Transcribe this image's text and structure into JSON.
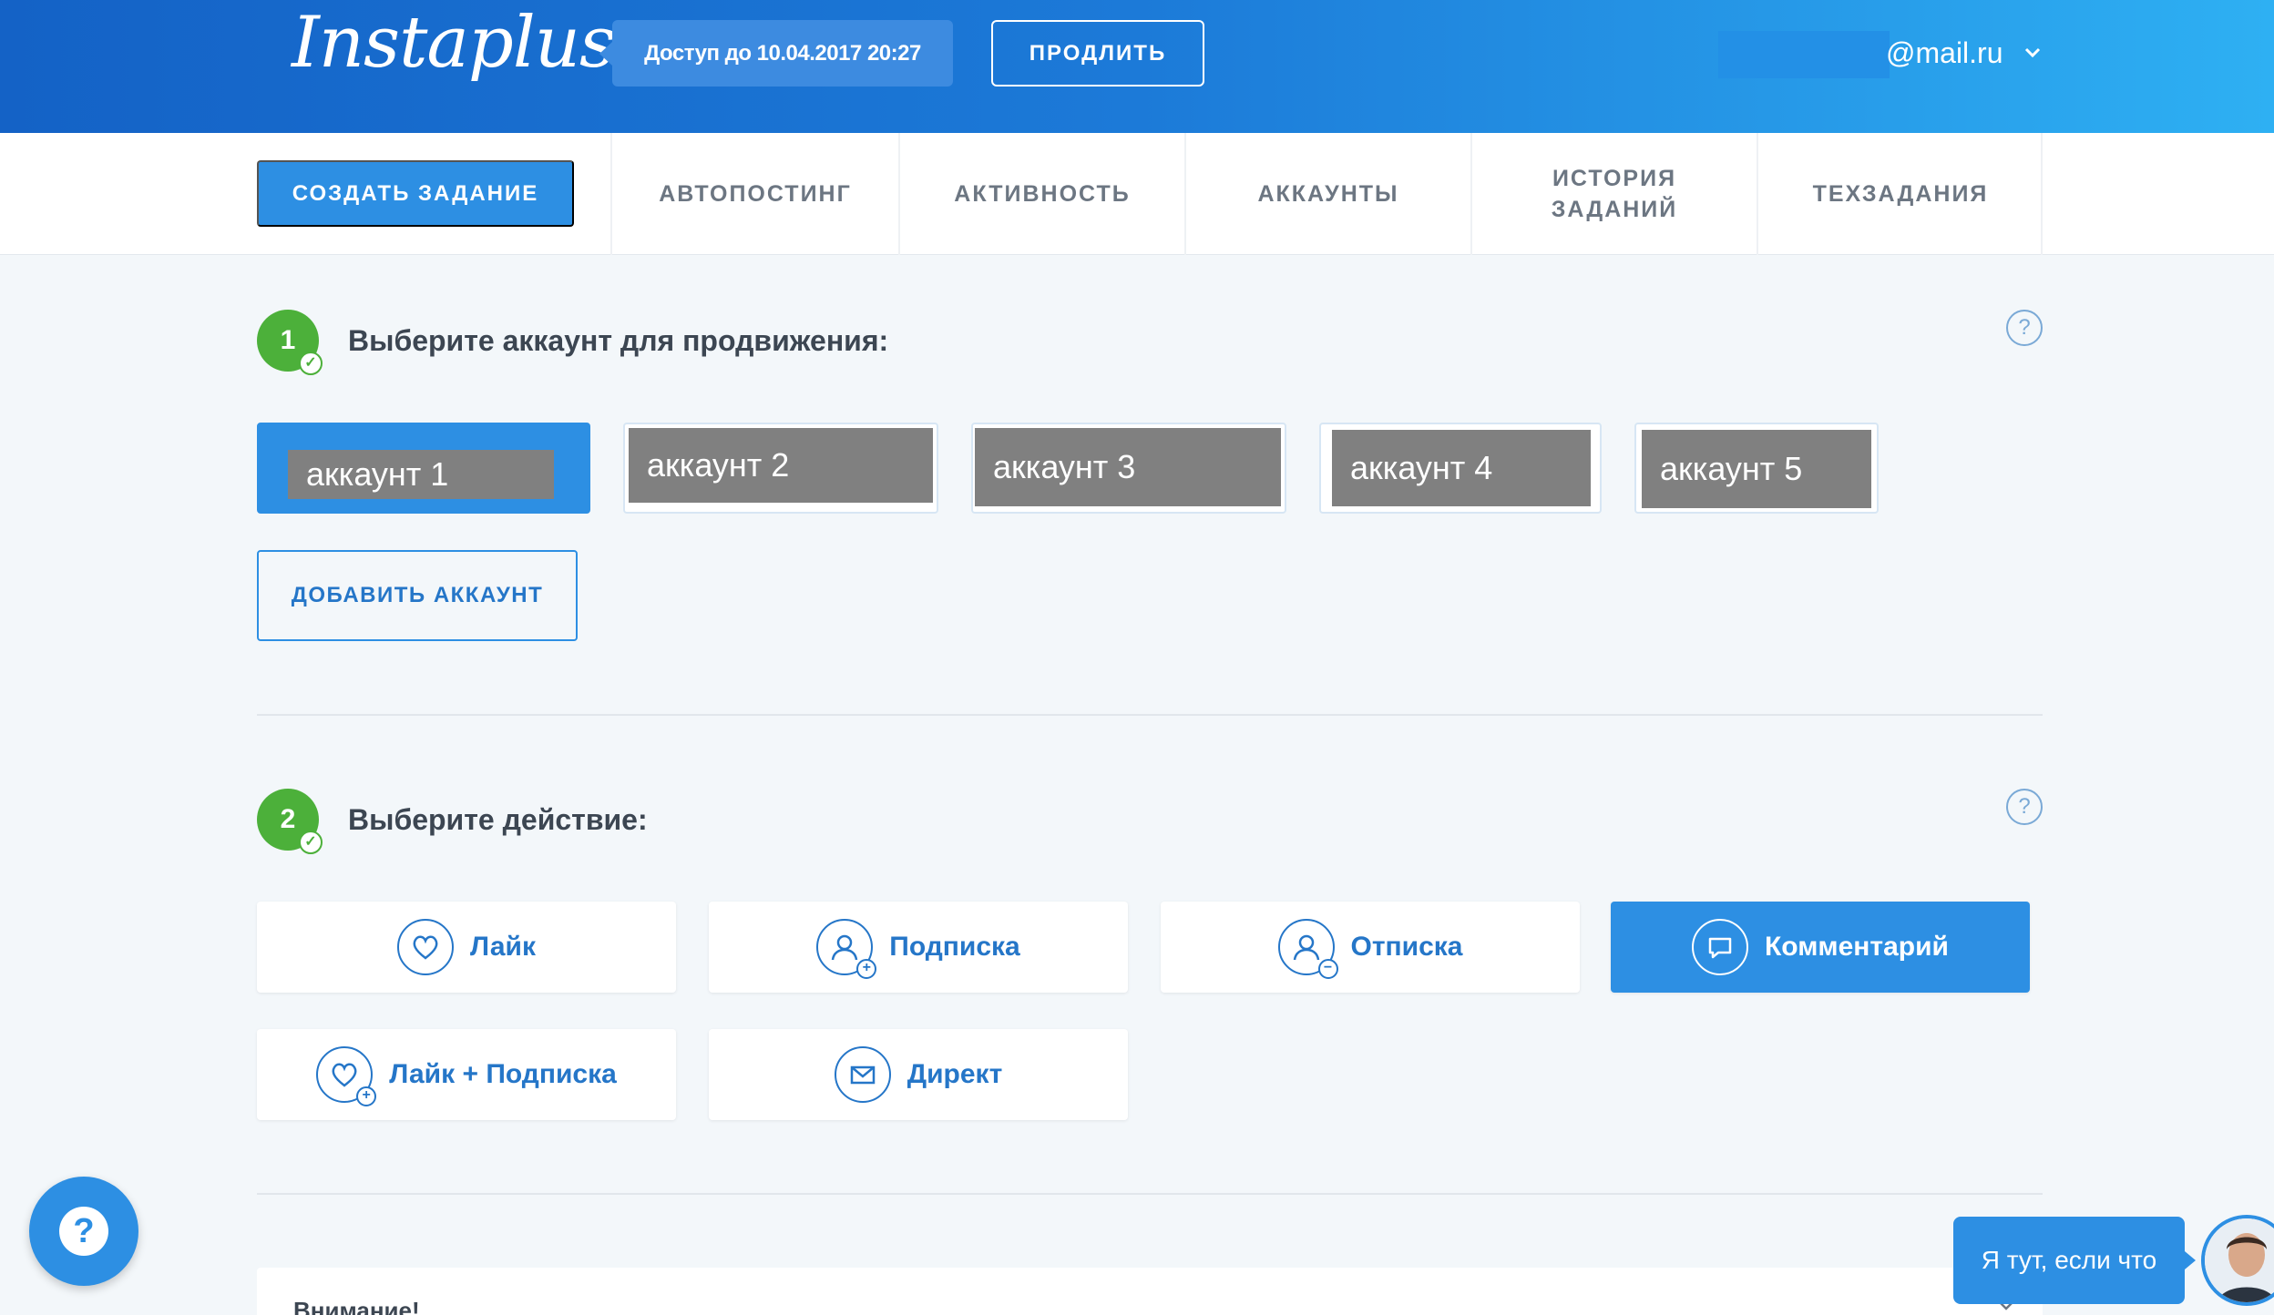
{
  "header": {
    "logo": "Instaplus",
    "access_text": "Доступ до 10.04.2017 20:27",
    "renew_label": "ПРОДЛИТЬ",
    "user_email": "@mail.ru",
    "user_chevron": "⌄"
  },
  "nav": {
    "create_label": "СОЗДАТЬ ЗАДАНИЕ",
    "tabs": [
      {
        "label": "АВТОПОСТИНГ"
      },
      {
        "label": "АКТИВНОСТЬ"
      },
      {
        "label": "АККАУНТЫ"
      },
      {
        "label": "ИСТОРИЯ ЗАДАНИЙ"
      },
      {
        "label": "ТЕХЗАДАНИЯ"
      }
    ]
  },
  "step1": {
    "number": "1",
    "title": "Выберите аккаунт для продвижения:",
    "help": "?",
    "accounts": [
      {
        "label": "аккаунт 1",
        "selected": true
      },
      {
        "label": "аккаунт 2",
        "selected": false
      },
      {
        "label": "аккаунт 3",
        "selected": false
      },
      {
        "label": "аккаунт 4",
        "selected": false
      },
      {
        "label": "аккаунт 5",
        "selected": false
      }
    ],
    "add_account_label": "ДОБАВИТЬ АККАУНТ"
  },
  "step2": {
    "number": "2",
    "title": "Выберите действие:",
    "help": "?",
    "actions": [
      {
        "label": "Лайк",
        "icon": "heart-icon",
        "selected": false
      },
      {
        "label": "Подписка",
        "icon": "user-plus-icon",
        "selected": false
      },
      {
        "label": "Отписка",
        "icon": "user-minus-icon",
        "selected": false
      },
      {
        "label": "Комментарий",
        "icon": "comment-icon",
        "selected": true
      },
      {
        "label": "Лайк + Подписка",
        "icon": "heart-plus-icon",
        "selected": false
      },
      {
        "label": "Директ",
        "icon": "envelope-icon",
        "selected": false
      }
    ]
  },
  "notice": {
    "title": "Внимание!"
  },
  "help_fab": "?",
  "chat": {
    "bubble_text": "Я тут, если что"
  },
  "colors": {
    "primary": "#2d8fe3",
    "step_green": "#4cb03a",
    "header_start": "#1462c6",
    "header_end": "#2eb0f3"
  }
}
